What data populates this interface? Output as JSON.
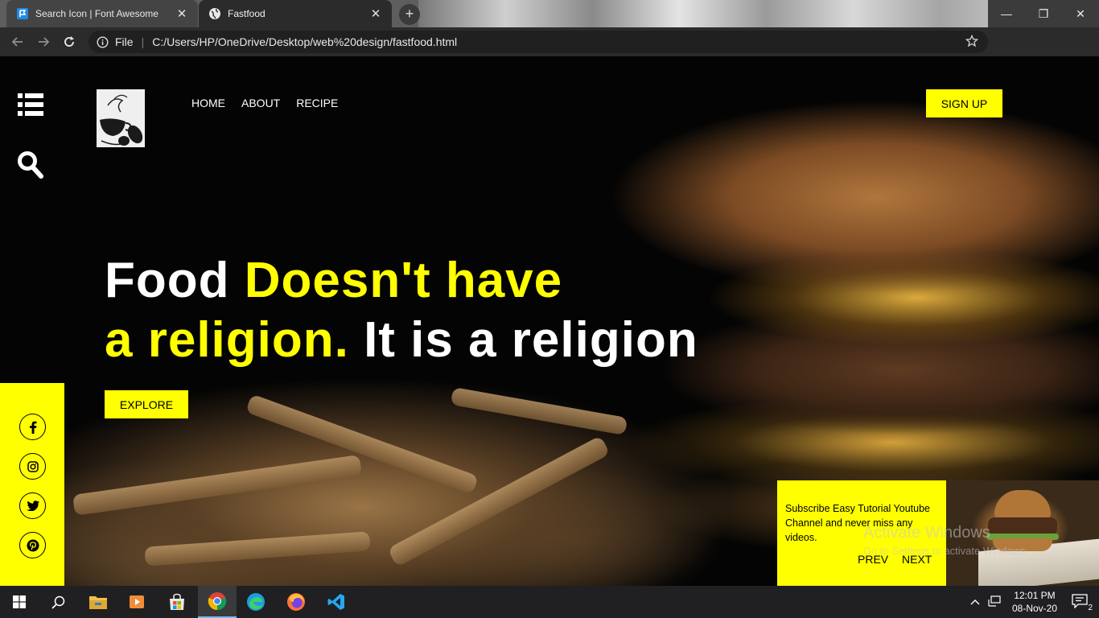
{
  "browser": {
    "tabs": [
      {
        "title": "Search Icon | Font Awesome",
        "close": "✕"
      },
      {
        "title": "Fastfood",
        "close": "✕"
      }
    ],
    "new_tab": "+",
    "window_controls": {
      "minimize": "—",
      "maximize": "❐",
      "close": "✕"
    },
    "address": {
      "scheme_label": "File",
      "url": "C:/Users/HP/OneDrive/Desktop/web%20design/fastfood.html"
    }
  },
  "page": {
    "nav": [
      "HOME",
      "ABOUT",
      "RECIPE"
    ],
    "signup_label": "SIGN UP",
    "headline": {
      "part1_white": "Food ",
      "part2_yellow": "Doesn't have",
      "part3_yellow": "a religion.",
      "part4_white": " It is a religion"
    },
    "explore_label": "EXPLORE",
    "social_icons": [
      "facebook-icon",
      "instagram-icon",
      "twitter-icon",
      "pinterest-icon"
    ],
    "promo": {
      "message": "Subscribe Easy Tutorial Youtube Channel and never miss any videos.",
      "prev_label": "PREV",
      "next_label": "NEXT"
    },
    "accent_color": "#ffff00"
  },
  "os": {
    "watermark_title": "Activate Windows",
    "watermark_sub": "Go to Settings to activate Windows.",
    "clock_time": "12:01 PM",
    "clock_date": "08-Nov-20",
    "notification_count": "2"
  }
}
